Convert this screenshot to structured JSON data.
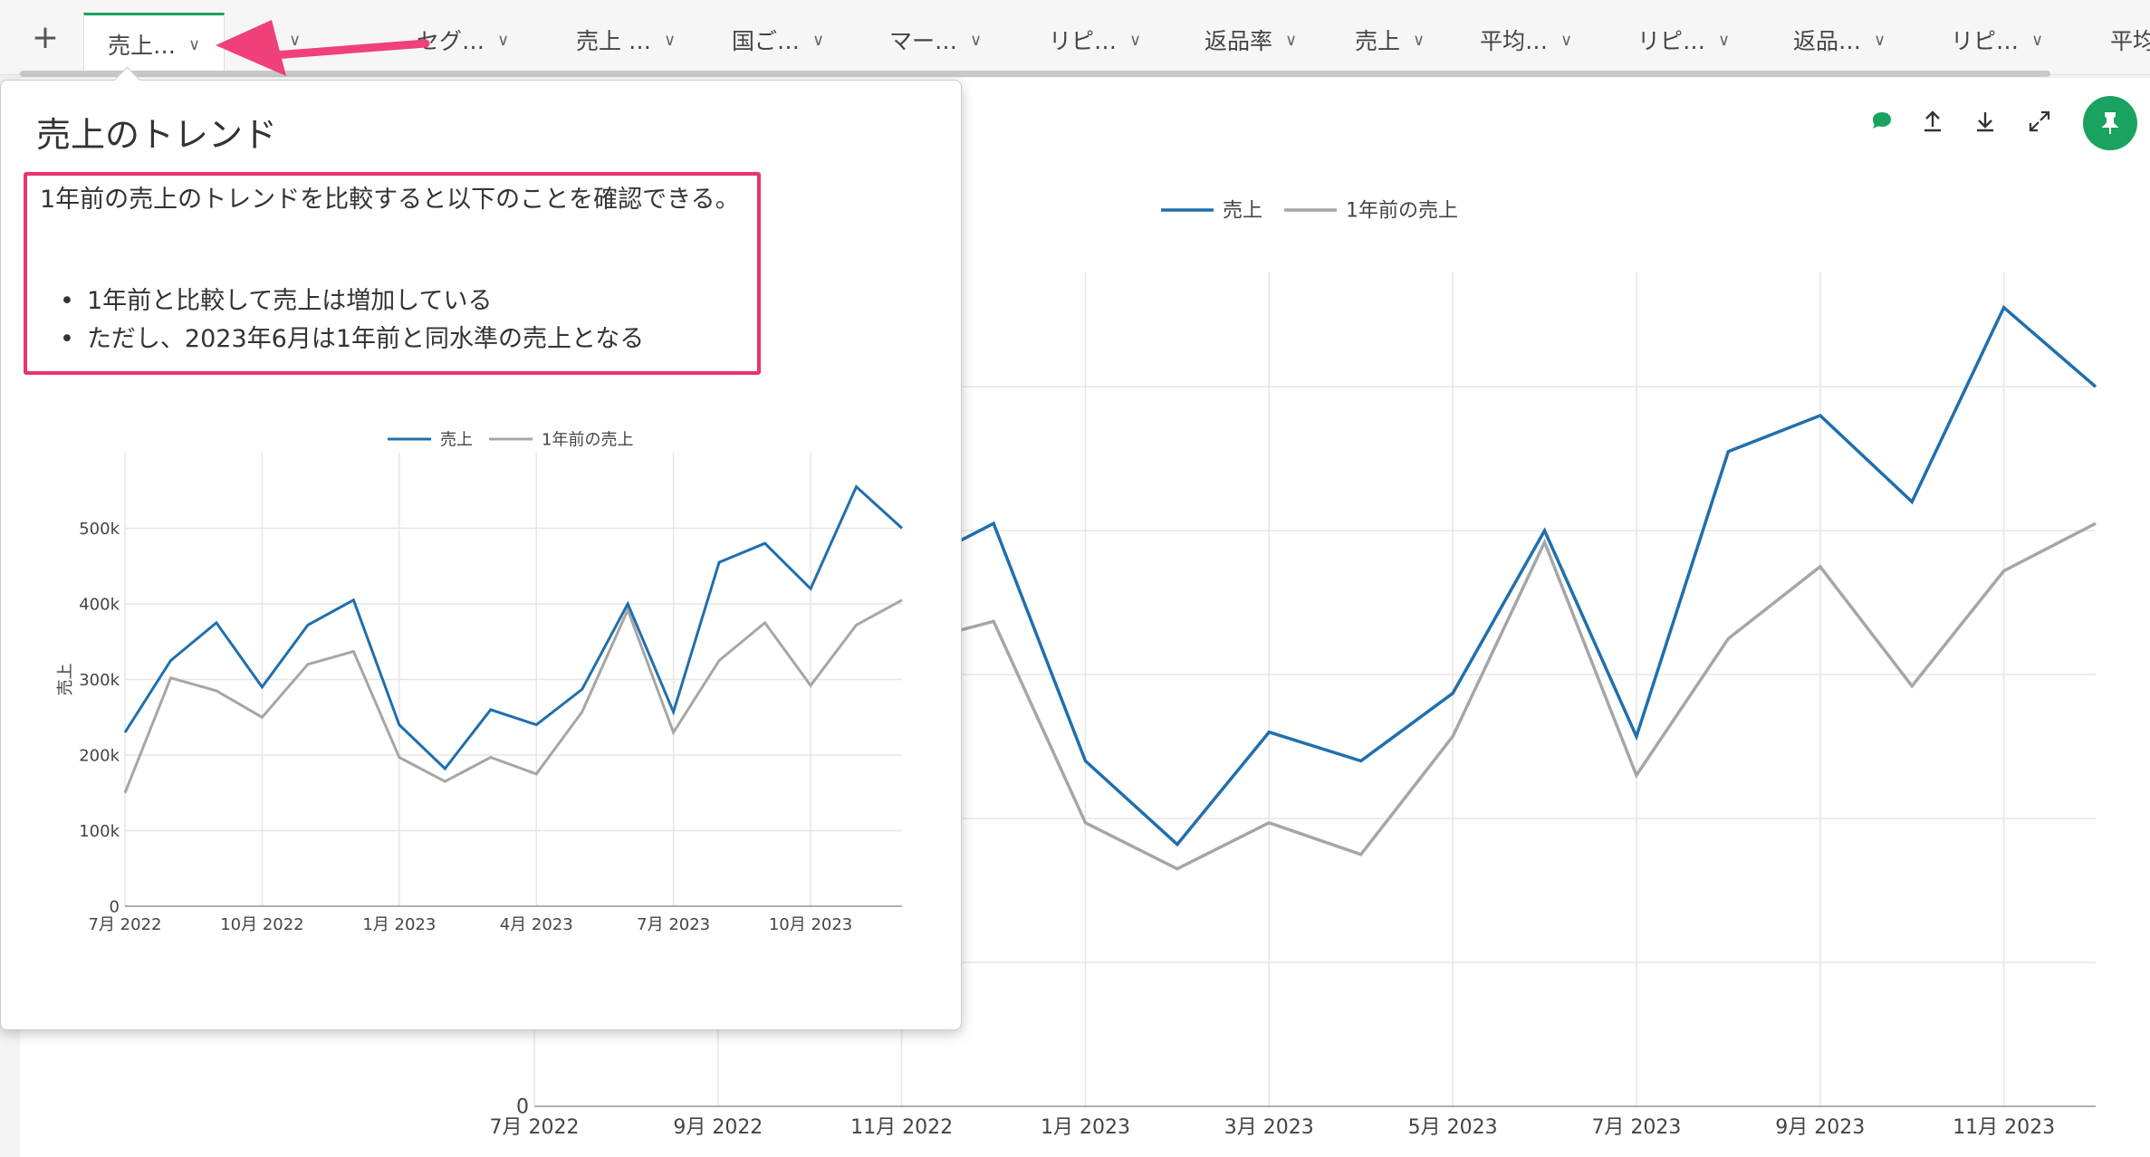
{
  "tabs": [
    {
      "label": "売上…",
      "active": true
    },
    {
      "label": "…",
      "active": false
    },
    {
      "label": "セグ…",
      "active": false
    },
    {
      "label": "売上 …",
      "active": false
    },
    {
      "label": "国ご…",
      "active": false
    },
    {
      "label": "マー…",
      "active": false
    },
    {
      "label": "リピ…",
      "active": false
    },
    {
      "label": "返品率",
      "active": false
    },
    {
      "label": "売上",
      "active": false
    },
    {
      "label": "平均…",
      "active": false
    },
    {
      "label": "リピ…",
      "active": false
    },
    {
      "label": "返品…",
      "active": false
    },
    {
      "label": "リピ…",
      "active": false
    },
    {
      "label": "平均",
      "active": false
    }
  ],
  "add_tab_label": "+",
  "popover": {
    "title": "売上のトレンド",
    "description": "1年前の売上のトレンドを比較すると以下のことを確認できる。",
    "bullets": [
      "1年前と比較して売上は増加している",
      "ただし、2023年6月は1年前と同水準の売上となる"
    ]
  },
  "colors": {
    "sales": "#1f6fae",
    "prev": "#a6a6a6",
    "accent": "#1aa260",
    "highlight": "#e8356b",
    "arrow": "#f0407a"
  },
  "icons": [
    "comment-icon",
    "upload-icon",
    "download-icon",
    "expand-icon",
    "pin-icon"
  ],
  "chart_data": [
    {
      "type": "line",
      "title": "",
      "ylabel": "売上",
      "xlabel": "",
      "legend": "top-center",
      "series": [
        {
          "name": "売上"
        },
        {
          "name": "1年前の売上"
        }
      ],
      "x": [
        "2022-07",
        "2022-08",
        "2022-09",
        "2022-10",
        "2022-11",
        "2022-12",
        "2023-01",
        "2023-02",
        "2023-03",
        "2023-04",
        "2023-05",
        "2023-06",
        "2023-07",
        "2023-08",
        "2023-09",
        "2023-10",
        "2023-11",
        "2023-12"
      ],
      "values_sales": [
        230000,
        325000,
        375000,
        290000,
        372000,
        405000,
        240000,
        182000,
        260000,
        240000,
        287000,
        400000,
        257000,
        455000,
        480000,
        420000,
        555000,
        500000
      ],
      "values_prev": [
        150000,
        302000,
        285000,
        250000,
        320000,
        337000,
        197000,
        165000,
        197000,
        175000,
        257000,
        392000,
        230000,
        325000,
        375000,
        292000,
        372000,
        405000
      ],
      "xticks": [
        "7月 2022",
        "10月 2022",
        "1月 2023",
        "4月 2023",
        "7月 2023",
        "10月 2023"
      ],
      "yticks": [
        "0",
        "100k",
        "200k",
        "300k",
        "400k",
        "500k"
      ],
      "ylim": [
        0,
        600000
      ],
      "grid": true
    },
    {
      "type": "line",
      "title": "",
      "ylabel": "",
      "xlabel": "",
      "legend": "top-center",
      "series": [
        {
          "name": "売上"
        },
        {
          "name": "1年前の売上"
        }
      ],
      "x": [
        "2022-07",
        "2022-08",
        "2022-09",
        "2022-10",
        "2022-11",
        "2022-12",
        "2023-01",
        "2023-02",
        "2023-03",
        "2023-04",
        "2023-05",
        "2023-06",
        "2023-07",
        "2023-08",
        "2023-09",
        "2023-10",
        "2023-11",
        "2023-12"
      ],
      "values_sales": [
        230000,
        325000,
        375000,
        290000,
        372000,
        405000,
        240000,
        182000,
        260000,
        240000,
        287000,
        400000,
        257000,
        455000,
        480000,
        420000,
        555000,
        500000
      ],
      "values_prev": [
        150000,
        302000,
        285000,
        250000,
        320000,
        337000,
        197000,
        165000,
        197000,
        175000,
        257000,
        392000,
        230000,
        325000,
        375000,
        292000,
        372000,
        405000
      ],
      "xticks": [
        "7月 2022",
        "9月 2022",
        "11月 2022",
        "1月 2023",
        "3月 2023",
        "5月 2023",
        "7月 2023",
        "9月 2023",
        "11月 2023"
      ],
      "yticks": [
        "0"
      ],
      "ylim": [
        0,
        580000
      ],
      "grid": true
    }
  ]
}
